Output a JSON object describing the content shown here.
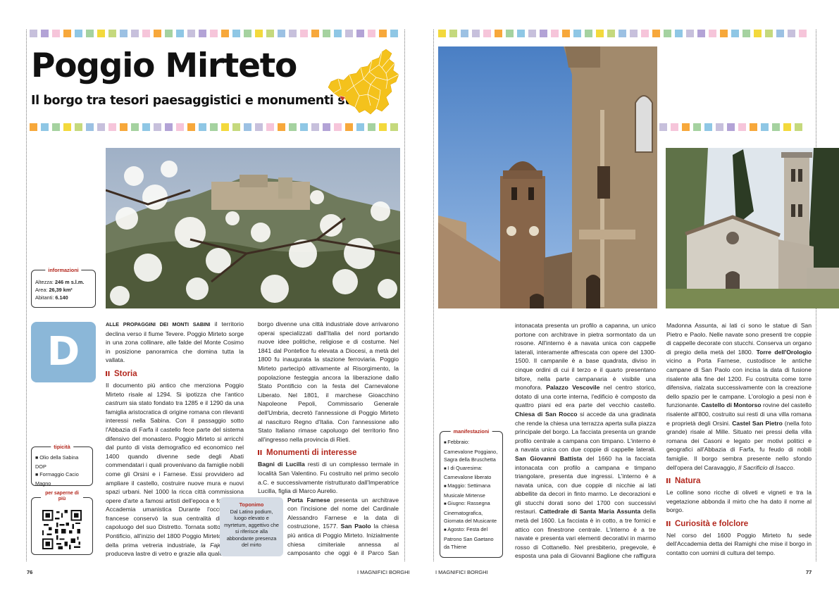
{
  "colors": {
    "stripe": [
      "#c7c0dc",
      "#b3a3d6",
      "#f6c5da",
      "#f7a83b",
      "#8fc7e5",
      "#a5d2a0",
      "#f3d93c",
      "#c5d97d",
      "#9cc1e3",
      "#c7c0dc",
      "#f6c5da",
      "#f7a83b",
      "#a5d2a0",
      "#8fc7e5"
    ],
    "accent": "#b3281e",
    "dropcap_bg": "#8bb7d8",
    "map_fill": "#f4c21c"
  },
  "header": {
    "title": "Poggio Mirteto",
    "subtitle": "Il borgo tra tesori paesaggistici e monumenti storici"
  },
  "info_box": {
    "title": "informazioni",
    "items": [
      {
        "label": "Altezza: ",
        "value": "246 m s.l.m."
      },
      {
        "label": "Area: ",
        "value": "26,39 km²"
      },
      {
        "label": "Abitanti: ",
        "value": "6.140"
      }
    ]
  },
  "dropcap": "D",
  "tipicita": {
    "title": "tipicità",
    "items": [
      "Olio della Sabina DOP",
      "Formaggio Cacio Magno"
    ]
  },
  "qr_box": {
    "title": "per saperne di più"
  },
  "toponimo": {
    "title": "Toponimo",
    "text": "Dal Latino podium, luogo elevato e myrtetum, aggettivo che si riferisce alla abbondante presenza del mirto"
  },
  "manifestazioni": {
    "title": "manifestazioni",
    "items": [
      "Febbraio: Carnevalone Poggiano, Sagra della Bruschetta",
      "I di Quaresima: Carnevalone liberato",
      "Maggio: Settimana Musicale Mirtense",
      "Giugno: Rassegna Cinematografica, Giornata del Musicante",
      "Agosto: Festa del Patrono San Gaetano da Thiene"
    ]
  },
  "sections": {
    "storia": "Storia",
    "monumenti": "Monumenti di interesse",
    "natura": "Natura",
    "curiosita": "Curiosità e folclore"
  },
  "text": {
    "col1_intro_caps": "ALLE PROPAGGINI DEI MONTI SABINI",
    "col1_intro": " il territorio declina verso il fiume Tevere. Poggio Mirteto sorge in una zona collinare, alle falde del Monte Cosimo in posizione panoramica che domina tutta la vallata.",
    "col1_storia_a": "Il documento più antico che menziona Poggio Mirteto risale al 1294. Si ipotizza che l'antico ",
    "col1_storia_castrum": "castrum",
    "col1_storia_b": " sia stato fondato tra 1285 e il 1290 da una famiglia aristocratica di origine romana con rilevanti interessi nella Sabina. Con il passaggio sotto l'Abbazia di Farfa il castello fece parte del sistema difensivo del monastero. Poggio Mirteto si arricchì dal punto di vista demografico ed economico nel 1400 quando divenne sede degli Abati commendatari i quali provenivano da famiglie nobili come gli Orsini e i Farnese. Essi provvidero ad ampliare il castello, costruire nuove mura e nuovi spazi urbani. Nel 1000 la ricca città commissiona opere d'arte a famosi artisti dell'epoca e fonda una Accademia umanistica Durante l'occupazione francese conservò la sua centralità divenendo capoluogo del suo Distretto. Tornata sotto lo Stato Pontificio, all'inizio del 1800 Poggio Mirteto fu sede della prima vetreria industriale, ",
    "col1_fajella": "la Fajella",
    "col1_storia_c": ", che produceva lastre di vetro e grazie alla quale il",
    "col2_a": "borgo divenne una città industriale dove arrivarono operai specializzati dall'Italia del nord portando nuove idee politiche, religiose e di costume. Nel 1841 dal Pontefice fu elevata a Diocesi, a metà del 1800 fu inaugurata la stazione ferroviaria. Poggio Mirteto partecipò attivamente al Risorgimento, la popolazione festeggia ancora la liberazione dallo Stato Pontificio con la festa del Carnevalone Liberato. Nel 1801, il marchese Gioacchino Napoleone Pepoli, Commissario Generale dell'Umbria, decretò l'annessione di Poggio Mirteto al nascituro Regno d'Italia. Con l'annessione allo Stato Italiano rimase capoluogo del territorio fino all'ingresso nella provincia di Rieti.",
    "col2_bagni": "Bagni di Lucilla",
    "col2_b": " resti di un complesso termale in località San Valentino. Fu costruito nel primo secolo a.C. e successivamente ristrutturato dall'Imperatrice Lucilla, figlia di Marco Aurelio.",
    "col2_porta": "Porta Farnese",
    "col2_c": " presenta un architrave con l'incisione del nome del Cardinale Alessandro Farnese e la data di costruzione, 1577. ",
    "col2_sanpaolo": "San Paolo",
    "col2_d": " la chiesa più antica di Poggio Mirteto. Inizialmente chiesa cimiteriale annessa al camposanto che oggi è il Parco San Paolo. La facciata",
    "col3_a": "intonacata presenta un profilo a capanna, un unico portone con architrave in pietra sormontato da un rosone. All'interno è a navata unica con cappelle laterali, interamente affrescata con opere del 1300-1500. Il campanile è a base quadrata, diviso in cinque ordini di cui il terzo e il quarto presentano bifore, nella parte campanaria è visibile una monofora. ",
    "col3_palazzo": "Palazzo Vescovile",
    "col3_b": " nel centro storico, dotato di una corte interna, l'edificio è composto da quattro piani ed era parte del vecchio castello. ",
    "col3_rocco": "Chiesa di San Rocco",
    "col3_c": " si accede da una gradinata che rende la chiesa una terrazza aperta sulla piazza principale del borgo. La facciata presenta un grande profilo centrale a campana con timpano. L'interno è a navata unica con due coppie di cappelle laterali. ",
    "col3_sgb": "San Giovanni Battista",
    "col3_d": " del 1660 ha la facciata intonacata con profilo a campana e timpano triangolare, presenta due ingressi. L'interno è a navata unica, con due coppie di nicchie ai lati abbellite da decori in finto marmo. Le decorazioni e gli stucchi dorati sono del 1700 con successivi restauri. ",
    "col3_catt": "Cattedrale di Santa Maria Assunta",
    "col3_e": " della metà del 1600. La facciata è in cotto, a tre fornici e attico con finestrone centrale. L'interno è a tre navate e presenta vari elementi decorativi in marmo rosso di Cottanello. Nel presbiterio, pregevole, è esposta una pala di Giovanni Baglione che raffigura la",
    "col4_a": "Madonna Assunta, ai lati ci sono le statue di San Pietro e Paolo. Nelle navate sono presenti tre coppie di cappelle decorate con stucchi. Conserva un organo di pregio della metà del 1800. ",
    "col4_torre": "Torre dell'Orologio",
    "col4_b": " vicino a Porta Farnese, custodisce le antiche campane di San Paolo con incisa la data di fusione risalente alla fine del 1200. Fu costruita come torre difensiva, rialzata successivamente con la creazione dello spazio per le campane. L'orologio a pesi non è funzionante. ",
    "col4_montorso": "Castello di Montorso",
    "col4_c": " rovine del castello risalente all'800, costruito sui resti di una villa romana e proprietà degli Orsini. ",
    "col4_csp": "Castel San Pietro",
    "col4_d": " (nella foto grande) risale al Mille. Situato nei pressi della villa romana dei Casoni e legato per motivi politici e geografici all'Abbazia di Farfa, fu feudo di nobili famiglie. Il borgo sembra presente nello sfondo dell'opera del Caravaggio, ",
    "col4_sacrificio": "Il Sacrificio di Isacco",
    "col4_e": ".",
    "col4_natura": "Le colline sono ricche di oliveti e vigneti e tra la vegetazione abbonda il mirto che ha dato il nome al borgo.",
    "col4_curiosita": "Nel corso del 1600 Poggio Mirteto fu sede dell'Accademia detta dei Ramighi che mise il borgo in contatto con uomini di cultura del tempo."
  },
  "footer": {
    "left_page": "76",
    "left_label": "I MAGNIFICI BORGHI",
    "right_label": "I MAGNIFICI BORGHI",
    "right_page": "77"
  }
}
